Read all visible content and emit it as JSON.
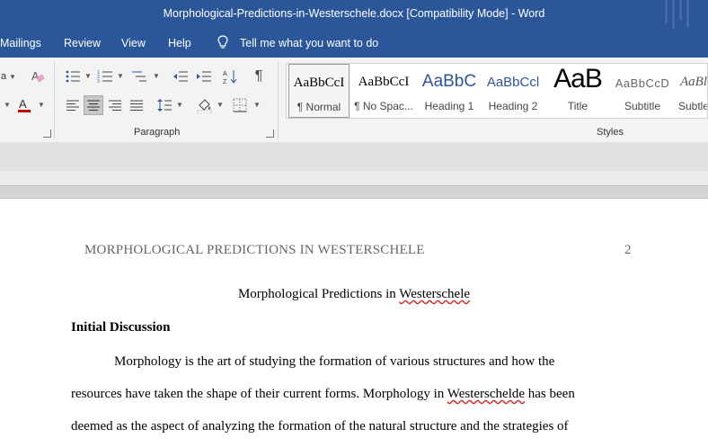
{
  "window": {
    "title": "Morphological-Predictions-in-Westerschele.docx [Compatibility Mode]  -  Word"
  },
  "tabs": [
    "Mailings",
    "Review",
    "View",
    "Help"
  ],
  "tell_me": "Tell me what you want to do",
  "ribbon": {
    "paragraph_label": "Paragraph",
    "styles_label": "Styles",
    "styles": [
      {
        "preview": "AaBbCcI",
        "name": "¶ Normal"
      },
      {
        "preview": "AaBbCcI",
        "name": "¶ No Spac..."
      },
      {
        "preview": "AaBbC",
        "name": "Heading 1"
      },
      {
        "preview": "AaBbCcl",
        "name": "Heading 2"
      },
      {
        "preview": "AaB",
        "name": "Title"
      },
      {
        "preview": "AaBbCcD",
        "name": "Subtitle"
      },
      {
        "preview": "AaBl",
        "name": "Subtle"
      }
    ],
    "colors": {
      "accent": "#2b579a",
      "font_color_bar": "#c00000"
    }
  },
  "document": {
    "header_text": "MORPHOLOGICAL PREDICTIONS IN WESTERSCHELE",
    "page_number": "2",
    "title_prefix": "Morphological Predictions in ",
    "title_misspelled": "Westerschele",
    "heading": "Initial Discussion",
    "line1": "Morphology is the art of studying the formation of various structures and how the",
    "line2_a": "resources have taken the shape of their current forms. Morphology in ",
    "line2_b": "Westerschelde",
    "line2_c": " has been",
    "line3": "deemed as the aspect of analyzing the formation of the natural structure and the strategies of"
  }
}
